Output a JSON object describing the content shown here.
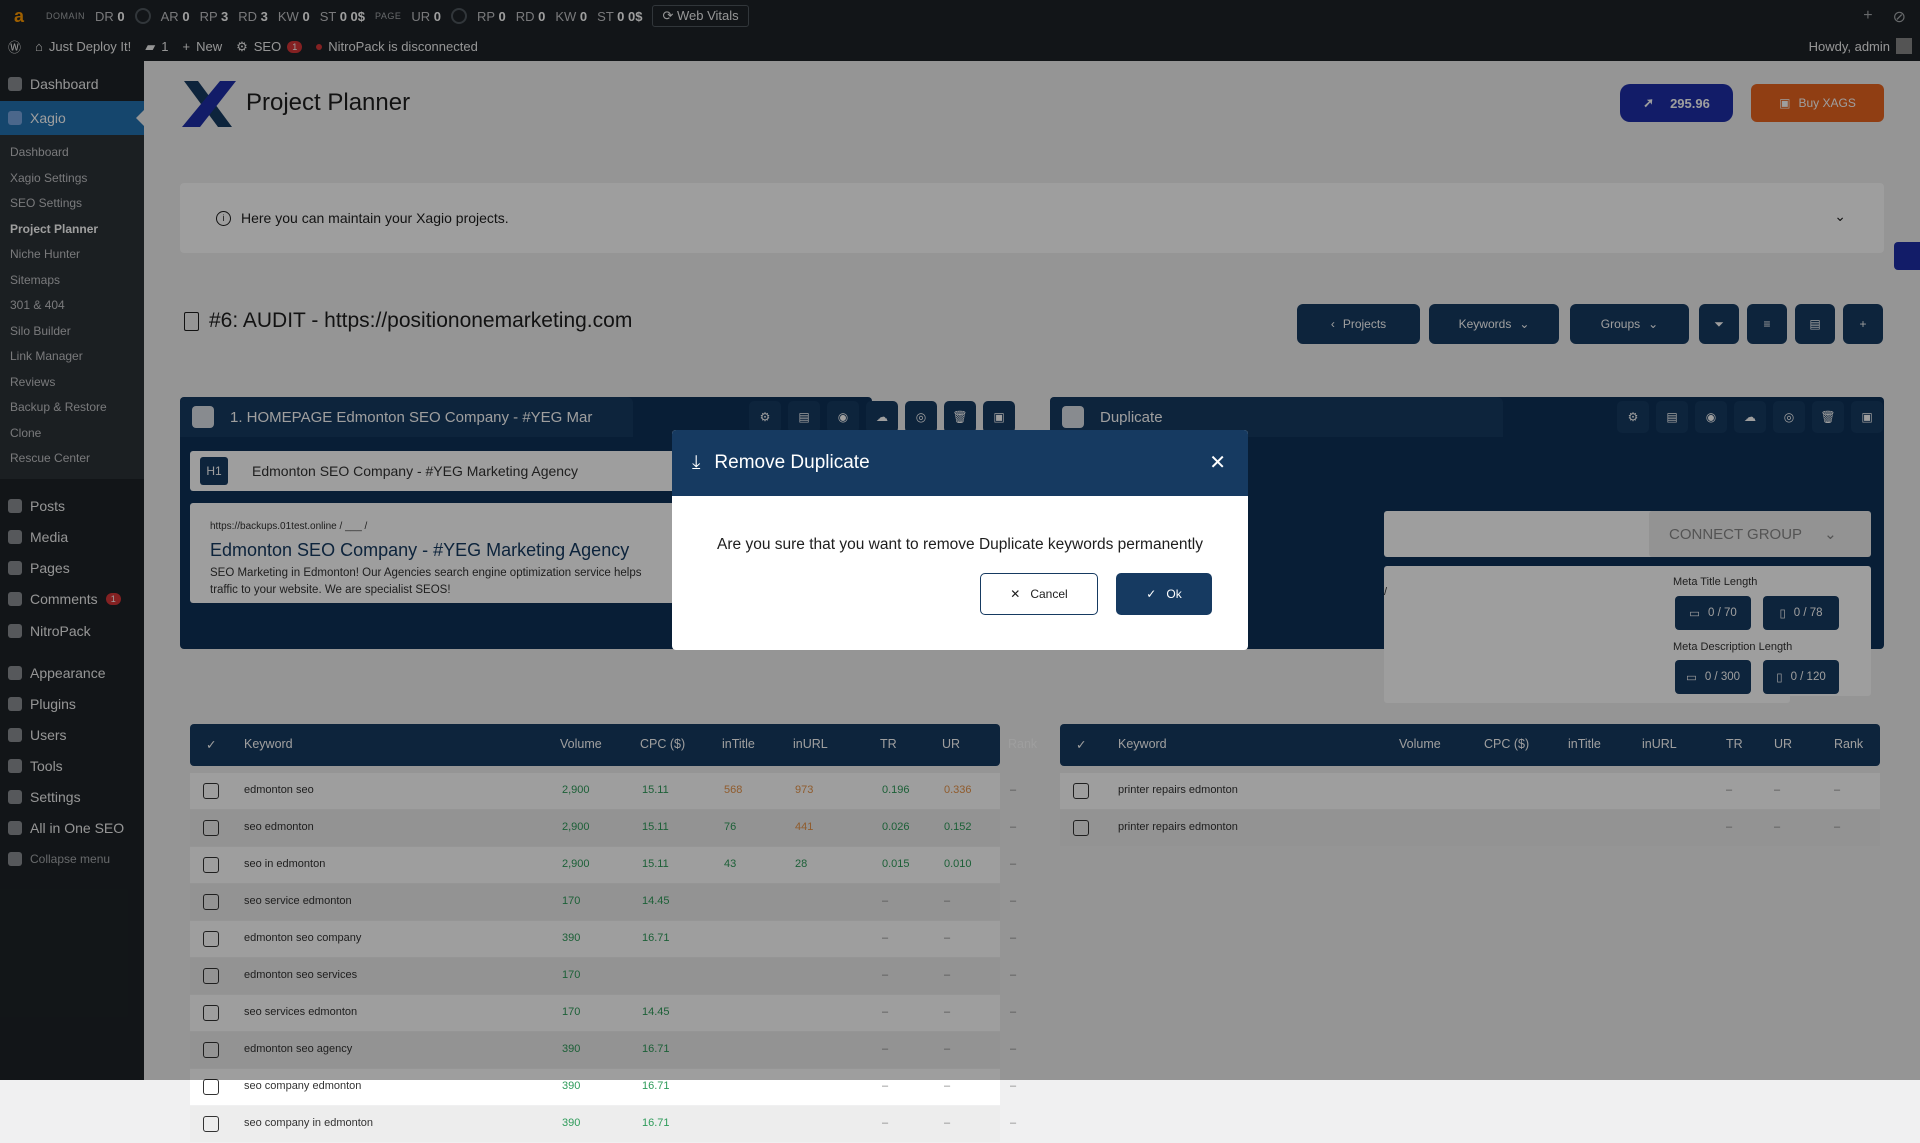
{
  "seobar": {
    "domain_label": "DOMAIN",
    "page_label": "PAGE",
    "domain": [
      {
        "k": "DR",
        "v": "0"
      },
      {
        "k": "AR",
        "v": "0"
      },
      {
        "k": "RP",
        "v": "3"
      },
      {
        "k": "RD",
        "v": "3"
      },
      {
        "k": "KW",
        "v": "0"
      },
      {
        "k": "ST",
        "v": "0 0$"
      }
    ],
    "page": [
      {
        "k": "UR",
        "v": "0"
      },
      {
        "k": "RP",
        "v": "0"
      },
      {
        "k": "RD",
        "v": "0"
      },
      {
        "k": "KW",
        "v": "0"
      },
      {
        "k": "ST",
        "v": "0 0$"
      }
    ],
    "web_vitals": "Web Vitals"
  },
  "adminbar": {
    "site": "Just Deploy It!",
    "comments": "1",
    "new": "New",
    "seo": "SEO",
    "seo_badge": "1",
    "nitro": "NitroPack is disconnected",
    "howdy": "Howdy, admin"
  },
  "sidebar": {
    "top": [
      {
        "label": "Dashboard"
      },
      {
        "label": "Xagio"
      }
    ],
    "sub": [
      "Dashboard",
      "Xagio Settings",
      "SEO Settings",
      "Project Planner",
      "Niche Hunter",
      "Sitemaps",
      "301 & 404",
      "Silo Builder",
      "Link Manager",
      "Reviews",
      "Backup & Restore",
      "Clone",
      "Rescue Center"
    ],
    "bottom": [
      "Posts",
      "Media",
      "Pages",
      "Comments",
      "NitroPack",
      "Appearance",
      "Plugins",
      "Users",
      "Tools",
      "Settings",
      "All in One SEO",
      "Collapse menu"
    ],
    "comments_badge": "1"
  },
  "header": {
    "title": "Project Planner",
    "credits": "295.96",
    "buy": "Buy XAGS"
  },
  "info": "Here you can maintain your Xagio projects.",
  "project_title": "#6: AUDIT - https://positiononemarketing.com",
  "toolbar": {
    "projects": "Projects",
    "keywords": "Keywords",
    "groups": "Groups"
  },
  "left_group": {
    "name": "1. HOMEPAGE Edmonton SEO Company - #YEG Mar",
    "h1_tag": "H1",
    "h1": "Edmonton SEO Company - #YEG Marketing Agency",
    "url": "https://backups.01test.online / ___ /",
    "title": "Edmonton SEO Company - #YEG Marketing Agency",
    "desc1": "SEO Marketing in Edmonton! Our Agencies search engine optimization service helps",
    "desc2": "traffic to your website. We are specialist SEOS!"
  },
  "right_group": {
    "name": "Duplicate",
    "url_tail": "/",
    "connect": "CONNECT GROUP",
    "meta_title_label": "Meta Title Length",
    "meta_desc_label": "Meta Description Length",
    "mt1": "0 / 70",
    "mt2": "0 / 78",
    "md1": "0 / 300",
    "md2": "0 / 120"
  },
  "columns": [
    "Keyword",
    "Volume",
    "CPC ($)",
    "inTitle",
    "inURL",
    "TR",
    "UR",
    "Rank"
  ],
  "left_rows": [
    [
      "edmonton seo",
      "2,900",
      "15.11",
      "568",
      "973",
      "0.196",
      "0.336",
      "–"
    ],
    [
      "seo edmonton",
      "2,900",
      "15.11",
      "76",
      "441",
      "0.026",
      "0.152",
      "–"
    ],
    [
      "seo in edmonton",
      "2,900",
      "15.11",
      "43",
      "28",
      "0.015",
      "0.010",
      "–"
    ],
    [
      "seo service edmonton",
      "170",
      "14.45",
      "",
      "",
      "–",
      "–",
      "–"
    ],
    [
      "edmonton seo company",
      "390",
      "16.71",
      "",
      "",
      "–",
      "–",
      "–"
    ],
    [
      "edmonton seo services",
      "170",
      "",
      "",
      "",
      "–",
      "–",
      "–"
    ],
    [
      "seo services edmonton",
      "170",
      "14.45",
      "",
      "",
      "–",
      "–",
      "–"
    ],
    [
      "edmonton seo agency",
      "390",
      "16.71",
      "",
      "",
      "–",
      "–",
      "–"
    ],
    [
      "seo company edmonton",
      "390",
      "16.71",
      "",
      "",
      "–",
      "–",
      "–"
    ],
    [
      "seo company in edmonton",
      "390",
      "16.71",
      "",
      "",
      "–",
      "–",
      "–"
    ]
  ],
  "right_rows": [
    [
      "printer repairs edmonton",
      "",
      "",
      "",
      "",
      "–",
      "–",
      "–"
    ],
    [
      "printer repairs edmonton",
      "",
      "",
      "",
      "",
      "–",
      "–",
      "–"
    ]
  ],
  "modal": {
    "title": "Remove Duplicate",
    "message": "Are you sure that you want to remove Duplicate keywords permanently",
    "cancel": "Cancel",
    "ok": "Ok"
  },
  "colors": {
    "navy": "#163a61",
    "accent": "#1d2ea8",
    "orange": "#e8641f",
    "green": "#2e9b5a"
  }
}
